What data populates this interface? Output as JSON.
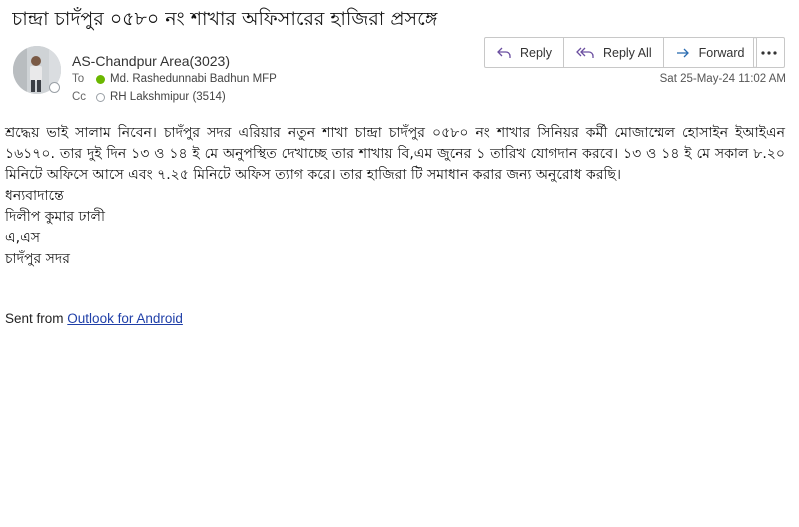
{
  "email": {
    "subject": "চান্দ্রা চাদঁপুর ০৫৮০ নং শাখার অফিসারের হাজিরা প্রসঙ্গে",
    "sender": "AS-Chandpur Area(3023)",
    "to_label": "To",
    "to": "Md. Rashedunnabi Badhun MFP",
    "cc_label": "Cc",
    "cc": "RH Lakshmipur (3514)",
    "date": "Sat 25-May-24 11:02 AM"
  },
  "actions": {
    "reply": "Reply",
    "reply_all": "Reply All",
    "forward": "Forward"
  },
  "body": {
    "paragraph": "শ্রদ্ধেয় ভাই সালাম নিবেন। চাদঁপুর সদর এরিয়ার নতুন শাখা চান্দ্রা চাদঁপুর ০৫৮০ নং শাখার সিনিয়র কর্মী মোজাম্মেল হোসাইন ইআইএন ১৬১৭০. তার দুই দিন ১৩ ও ১৪ ই মে অনুপস্থিত দেখাচ্ছে তার শাখায় বি,এম জুনের ১ তারিখ যোগদান করবে। ১৩ ও ১৪ ই মে সকাল ৮.২০ মিনিটে অফিসে আসে এবং ৭.২৫ মিনিটে অফিস ত্যাগ করে। তার হাজিরা টি সমাধান করার জন্য অনুরোধ করছি।",
    "closing": "ধন্যবাদান্তে",
    "name": "দিলীপ কুমার ঢালী",
    "title": "এ,এস",
    "location": "চাদঁপুর সদর"
  },
  "footer": {
    "sent_from": "Sent from",
    "link": "Outlook for Android"
  },
  "colors": {
    "presence_green": "#6bb700",
    "link_blue": "#1f3fa8"
  }
}
